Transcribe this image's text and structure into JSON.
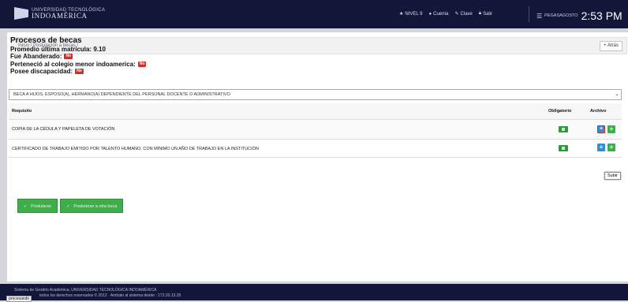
{
  "topbar": {
    "brand_top": "UNIVERSIDAD TECNOLÓGICA",
    "brand_main": "INDOAMÉRICA",
    "nav": [
      {
        "icon": "star-icon",
        "glyph": "★",
        "label": "NIVEL 9"
      },
      {
        "icon": "user-icon",
        "glyph": "●",
        "label": "Cuenta"
      },
      {
        "icon": "wrench-icon",
        "glyph": "✎",
        "label": "Clave"
      },
      {
        "icon": "lock-icon",
        "glyph": "🔒︎",
        "label": "Salir"
      }
    ],
    "clock_label": "PEGASAGOSTO",
    "time": "2:53 PM"
  },
  "breadcrumb": "Inicio / Postulación a becas /",
  "back_button": "Atrás",
  "info": {
    "title": "Procesos de becas",
    "promedio": "Promedio última matrícula: 9.10",
    "abanderado_label": "Fue Abanderado:",
    "colegio_label": "Perteneció al colegio menor indoamerica:",
    "discapacidad_label": "Posee discapacidad:",
    "no": "No"
  },
  "beca_select": "BECA A HIJOS, ESPOSO(A), HERMANO(A) DEPENDIENTE DEL PERSONAL DOCENTE O ADMINISTRATIVO",
  "table": {
    "headers": [
      "Requisito",
      "Obligatorio",
      "Archivo"
    ],
    "rows": [
      {
        "requisito": "COPIA DE LA CÉDULA Y PAPELETA DE VOTACIÓN"
      },
      {
        "requisito": "CERTIFICADO DE TRABAJO EMITIDO POR TALENTO HUMANO, CON MÍNIMO UN AÑO DE TRABAJO EN LA INSTITUCIÓN"
      }
    ]
  },
  "tooltip": "Subir",
  "buttons": [
    "Postularse",
    "Postularse a otra beca"
  ],
  "footer": {
    "line1": "Sistema de Gestión Académica, UNIVERSIDAD TECNOLÓGICA INDOAMÉRICA",
    "line2": "todos los derechos reservados © 2012 · Ambato al sistema desde : 172.20.13.35"
  },
  "toast": "procesando"
}
